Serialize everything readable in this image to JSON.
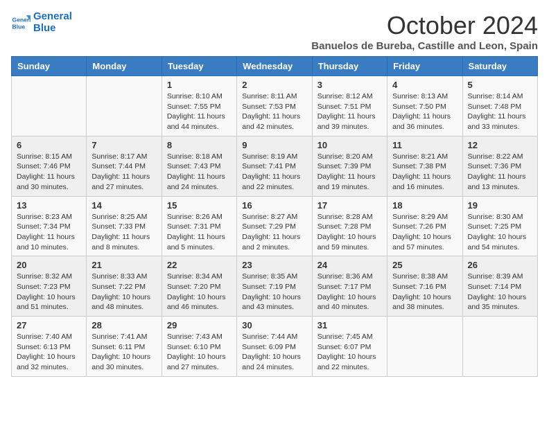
{
  "logo": {
    "line1": "General",
    "line2": "Blue"
  },
  "title": "October 2024",
  "subtitle": "Banuelos de Bureba, Castille and Leon, Spain",
  "days_of_week": [
    "Sunday",
    "Monday",
    "Tuesday",
    "Wednesday",
    "Thursday",
    "Friday",
    "Saturday"
  ],
  "weeks": [
    [
      {
        "day": "",
        "sunrise": "",
        "sunset": "",
        "daylight": ""
      },
      {
        "day": "",
        "sunrise": "",
        "sunset": "",
        "daylight": ""
      },
      {
        "day": "1",
        "sunrise": "Sunrise: 8:10 AM",
        "sunset": "Sunset: 7:55 PM",
        "daylight": "Daylight: 11 hours and 44 minutes."
      },
      {
        "day": "2",
        "sunrise": "Sunrise: 8:11 AM",
        "sunset": "Sunset: 7:53 PM",
        "daylight": "Daylight: 11 hours and 42 minutes."
      },
      {
        "day": "3",
        "sunrise": "Sunrise: 8:12 AM",
        "sunset": "Sunset: 7:51 PM",
        "daylight": "Daylight: 11 hours and 39 minutes."
      },
      {
        "day": "4",
        "sunrise": "Sunrise: 8:13 AM",
        "sunset": "Sunset: 7:50 PM",
        "daylight": "Daylight: 11 hours and 36 minutes."
      },
      {
        "day": "5",
        "sunrise": "Sunrise: 8:14 AM",
        "sunset": "Sunset: 7:48 PM",
        "daylight": "Daylight: 11 hours and 33 minutes."
      }
    ],
    [
      {
        "day": "6",
        "sunrise": "Sunrise: 8:15 AM",
        "sunset": "Sunset: 7:46 PM",
        "daylight": "Daylight: 11 hours and 30 minutes."
      },
      {
        "day": "7",
        "sunrise": "Sunrise: 8:17 AM",
        "sunset": "Sunset: 7:44 PM",
        "daylight": "Daylight: 11 hours and 27 minutes."
      },
      {
        "day": "8",
        "sunrise": "Sunrise: 8:18 AM",
        "sunset": "Sunset: 7:43 PM",
        "daylight": "Daylight: 11 hours and 24 minutes."
      },
      {
        "day": "9",
        "sunrise": "Sunrise: 8:19 AM",
        "sunset": "Sunset: 7:41 PM",
        "daylight": "Daylight: 11 hours and 22 minutes."
      },
      {
        "day": "10",
        "sunrise": "Sunrise: 8:20 AM",
        "sunset": "Sunset: 7:39 PM",
        "daylight": "Daylight: 11 hours and 19 minutes."
      },
      {
        "day": "11",
        "sunrise": "Sunrise: 8:21 AM",
        "sunset": "Sunset: 7:38 PM",
        "daylight": "Daylight: 11 hours and 16 minutes."
      },
      {
        "day": "12",
        "sunrise": "Sunrise: 8:22 AM",
        "sunset": "Sunset: 7:36 PM",
        "daylight": "Daylight: 11 hours and 13 minutes."
      }
    ],
    [
      {
        "day": "13",
        "sunrise": "Sunrise: 8:23 AM",
        "sunset": "Sunset: 7:34 PM",
        "daylight": "Daylight: 11 hours and 10 minutes."
      },
      {
        "day": "14",
        "sunrise": "Sunrise: 8:25 AM",
        "sunset": "Sunset: 7:33 PM",
        "daylight": "Daylight: 11 hours and 8 minutes."
      },
      {
        "day": "15",
        "sunrise": "Sunrise: 8:26 AM",
        "sunset": "Sunset: 7:31 PM",
        "daylight": "Daylight: 11 hours and 5 minutes."
      },
      {
        "day": "16",
        "sunrise": "Sunrise: 8:27 AM",
        "sunset": "Sunset: 7:29 PM",
        "daylight": "Daylight: 11 hours and 2 minutes."
      },
      {
        "day": "17",
        "sunrise": "Sunrise: 8:28 AM",
        "sunset": "Sunset: 7:28 PM",
        "daylight": "Daylight: 10 hours and 59 minutes."
      },
      {
        "day": "18",
        "sunrise": "Sunrise: 8:29 AM",
        "sunset": "Sunset: 7:26 PM",
        "daylight": "Daylight: 10 hours and 57 minutes."
      },
      {
        "day": "19",
        "sunrise": "Sunrise: 8:30 AM",
        "sunset": "Sunset: 7:25 PM",
        "daylight": "Daylight: 10 hours and 54 minutes."
      }
    ],
    [
      {
        "day": "20",
        "sunrise": "Sunrise: 8:32 AM",
        "sunset": "Sunset: 7:23 PM",
        "daylight": "Daylight: 10 hours and 51 minutes."
      },
      {
        "day": "21",
        "sunrise": "Sunrise: 8:33 AM",
        "sunset": "Sunset: 7:22 PM",
        "daylight": "Daylight: 10 hours and 48 minutes."
      },
      {
        "day": "22",
        "sunrise": "Sunrise: 8:34 AM",
        "sunset": "Sunset: 7:20 PM",
        "daylight": "Daylight: 10 hours and 46 minutes."
      },
      {
        "day": "23",
        "sunrise": "Sunrise: 8:35 AM",
        "sunset": "Sunset: 7:19 PM",
        "daylight": "Daylight: 10 hours and 43 minutes."
      },
      {
        "day": "24",
        "sunrise": "Sunrise: 8:36 AM",
        "sunset": "Sunset: 7:17 PM",
        "daylight": "Daylight: 10 hours and 40 minutes."
      },
      {
        "day": "25",
        "sunrise": "Sunrise: 8:38 AM",
        "sunset": "Sunset: 7:16 PM",
        "daylight": "Daylight: 10 hours and 38 minutes."
      },
      {
        "day": "26",
        "sunrise": "Sunrise: 8:39 AM",
        "sunset": "Sunset: 7:14 PM",
        "daylight": "Daylight: 10 hours and 35 minutes."
      }
    ],
    [
      {
        "day": "27",
        "sunrise": "Sunrise: 7:40 AM",
        "sunset": "Sunset: 6:13 PM",
        "daylight": "Daylight: 10 hours and 32 minutes."
      },
      {
        "day": "28",
        "sunrise": "Sunrise: 7:41 AM",
        "sunset": "Sunset: 6:11 PM",
        "daylight": "Daylight: 10 hours and 30 minutes."
      },
      {
        "day": "29",
        "sunrise": "Sunrise: 7:43 AM",
        "sunset": "Sunset: 6:10 PM",
        "daylight": "Daylight: 10 hours and 27 minutes."
      },
      {
        "day": "30",
        "sunrise": "Sunrise: 7:44 AM",
        "sunset": "Sunset: 6:09 PM",
        "daylight": "Daylight: 10 hours and 24 minutes."
      },
      {
        "day": "31",
        "sunrise": "Sunrise: 7:45 AM",
        "sunset": "Sunset: 6:07 PM",
        "daylight": "Daylight: 10 hours and 22 minutes."
      },
      {
        "day": "",
        "sunrise": "",
        "sunset": "",
        "daylight": ""
      },
      {
        "day": "",
        "sunrise": "",
        "sunset": "",
        "daylight": ""
      }
    ]
  ]
}
